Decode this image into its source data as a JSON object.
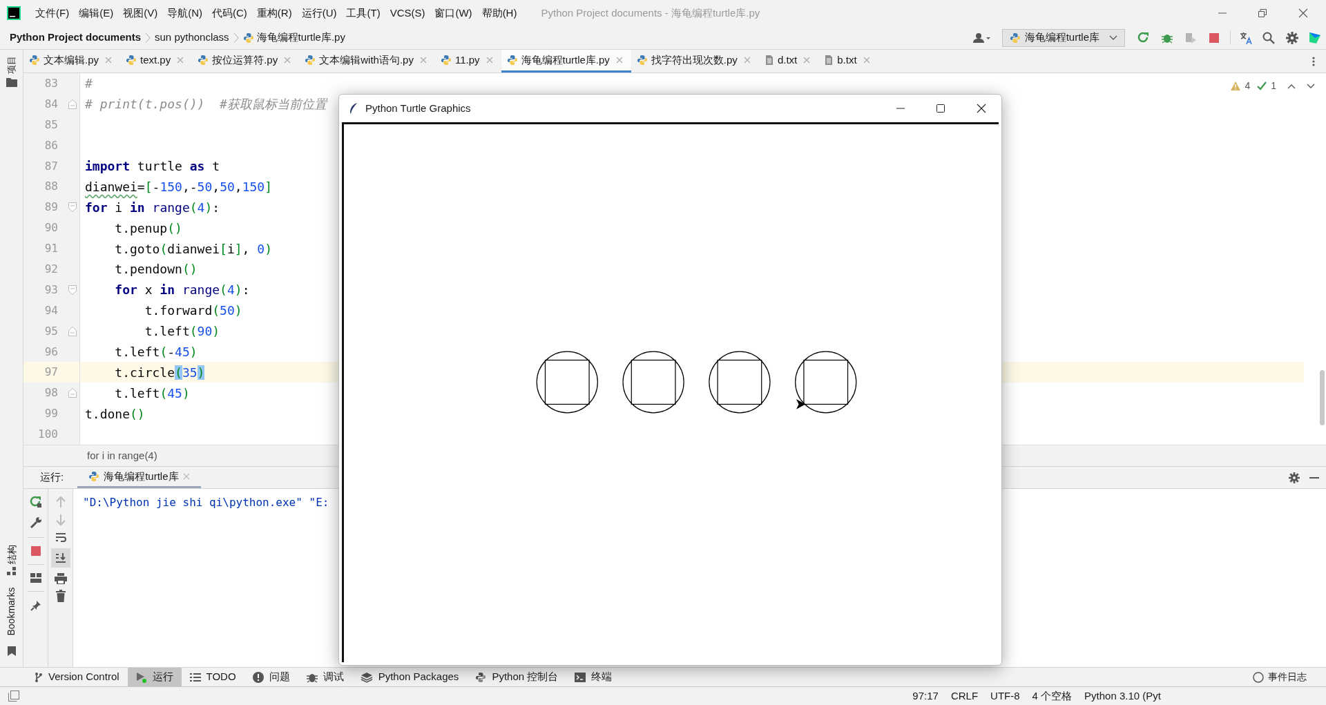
{
  "title_bar": {
    "menus": [
      "文件(F)",
      "编辑(E)",
      "视图(V)",
      "导航(N)",
      "代码(C)",
      "重构(R)",
      "运行(U)",
      "工具(T)",
      "VCS(S)",
      "窗口(W)",
      "帮助(H)"
    ],
    "title": "Python Project documents - 海龟编程turtle库.py"
  },
  "navigation_bar": {
    "breadcrumbs": [
      "Python Project documents",
      "sun pythonclass",
      "海龟编程turtle库.py"
    ],
    "run_configuration": "海龟编程turtle库"
  },
  "left_strip": {
    "top": [
      "项目"
    ],
    "bottom": [
      "结构",
      "Bookmarks"
    ]
  },
  "editor_tabs": [
    {
      "label": "文本编辑.py",
      "kind": "python",
      "selected": false
    },
    {
      "label": "text.py",
      "kind": "python",
      "selected": false
    },
    {
      "label": "按位运算符.py",
      "kind": "python",
      "selected": false
    },
    {
      "label": "文本编辑with语句.py",
      "kind": "python",
      "selected": false
    },
    {
      "label": "11.py",
      "kind": "python",
      "selected": false
    },
    {
      "label": "海龟编程turtle库.py",
      "kind": "python",
      "selected": true
    },
    {
      "label": "找字符出现次数.py",
      "kind": "python",
      "selected": false
    },
    {
      "label": "d.txt",
      "kind": "text",
      "selected": false
    },
    {
      "label": "b.txt",
      "kind": "text",
      "selected": false
    }
  ],
  "editor": {
    "inspections": {
      "warnings": "4",
      "passed": "1"
    },
    "lines": [
      {
        "number": "83",
        "kind": "plain",
        "current": false,
        "tokens": [
          {
            "kind": "comment",
            "text": "#"
          }
        ]
      },
      {
        "number": "84",
        "kind": "fold-end",
        "current": false,
        "tokens": [
          {
            "kind": "comment",
            "text": "# print(t.pos())  #获取鼠标当前位置"
          }
        ]
      },
      {
        "number": "85",
        "kind": "plain",
        "current": false
      },
      {
        "number": "86",
        "kind": "plain",
        "current": false
      },
      {
        "number": "87",
        "kind": "plain",
        "current": false,
        "tokens": [
          {
            "kind": "keyword",
            "text": "import"
          },
          {
            "kind": "plain",
            "text": " turtle "
          },
          {
            "kind": "keyword",
            "text": "as"
          },
          {
            "kind": "plain",
            "text": " t"
          }
        ]
      },
      {
        "number": "88",
        "kind": "plain",
        "current": false,
        "tokens": [
          {
            "kind": "typo",
            "text": "dianwei"
          },
          {
            "kind": "plain",
            "text": "="
          },
          {
            "kind": "bracket",
            "text": "["
          },
          {
            "kind": "plain",
            "text": "-"
          },
          {
            "kind": "number",
            "text": "150"
          },
          {
            "kind": "plain",
            "text": ",-"
          },
          {
            "kind": "number",
            "text": "50"
          },
          {
            "kind": "plain",
            "text": ","
          },
          {
            "kind": "number",
            "text": "50"
          },
          {
            "kind": "plain",
            "text": ","
          },
          {
            "kind": "number",
            "text": "150"
          },
          {
            "kind": "bracket",
            "text": "]"
          }
        ]
      },
      {
        "number": "89",
        "kind": "fold-start",
        "current": false,
        "tokens": [
          {
            "kind": "keyword",
            "text": "for"
          },
          {
            "kind": "plain",
            "text": " i "
          },
          {
            "kind": "keyword",
            "text": "in"
          },
          {
            "kind": "builtin",
            "text": " range"
          },
          {
            "kind": "bracket",
            "text": "("
          },
          {
            "kind": "number",
            "text": "4"
          },
          {
            "kind": "bracket",
            "text": ")"
          },
          {
            "kind": "plain",
            "text": ":"
          }
        ]
      },
      {
        "number": "90",
        "kind": "plain",
        "current": false,
        "tokens": [
          {
            "kind": "plain",
            "text": "    t.penup"
          },
          {
            "kind": "bracket",
            "text": "()"
          }
        ]
      },
      {
        "number": "91",
        "kind": "plain",
        "current": false,
        "tokens": [
          {
            "kind": "plain",
            "text": "    t.goto"
          },
          {
            "kind": "bracket",
            "text": "("
          },
          {
            "kind": "plain",
            "text": "dianwei"
          },
          {
            "kind": "bracket",
            "text": "["
          },
          {
            "kind": "plain",
            "text": "i"
          },
          {
            "kind": "bracket",
            "text": "]"
          },
          {
            "kind": "plain",
            "text": ", "
          },
          {
            "kind": "number",
            "text": "0"
          },
          {
            "kind": "bracket",
            "text": ")"
          }
        ]
      },
      {
        "number": "92",
        "kind": "plain",
        "current": false,
        "tokens": [
          {
            "kind": "plain",
            "text": "    t.pendown"
          },
          {
            "kind": "bracket",
            "text": "()"
          }
        ]
      },
      {
        "number": "93",
        "kind": "fold-start",
        "current": false,
        "tokens": [
          {
            "kind": "keyword",
            "text": "    for"
          },
          {
            "kind": "plain",
            "text": " x "
          },
          {
            "kind": "keyword",
            "text": "in"
          },
          {
            "kind": "builtin",
            "text": " range"
          },
          {
            "kind": "bracket",
            "text": "("
          },
          {
            "kind": "number",
            "text": "4"
          },
          {
            "kind": "bracket",
            "text": ")"
          },
          {
            "kind": "plain",
            "text": ":"
          }
        ]
      },
      {
        "number": "94",
        "kind": "plain",
        "current": false,
        "tokens": [
          {
            "kind": "plain",
            "text": "        t.forward"
          },
          {
            "kind": "bracket",
            "text": "("
          },
          {
            "kind": "number",
            "text": "50"
          },
          {
            "kind": "bracket",
            "text": ")"
          }
        ]
      },
      {
        "number": "95",
        "kind": "fold-end",
        "current": false,
        "tokens": [
          {
            "kind": "plain",
            "text": "        t.left"
          },
          {
            "kind": "bracket",
            "text": "("
          },
          {
            "kind": "number",
            "text": "90"
          },
          {
            "kind": "bracket",
            "text": ")"
          }
        ]
      },
      {
        "number": "96",
        "kind": "plain",
        "current": false,
        "tokens": [
          {
            "kind": "plain",
            "text": "    t.left"
          },
          {
            "kind": "bracket",
            "text": "("
          },
          {
            "kind": "plain",
            "text": "-"
          },
          {
            "kind": "number",
            "text": "45"
          },
          {
            "kind": "bracket",
            "text": ")"
          }
        ]
      },
      {
        "number": "97",
        "kind": "plain",
        "current": true,
        "tokens": [
          {
            "kind": "plain",
            "text": "    t.circle"
          },
          {
            "kind": "matched",
            "text": "("
          },
          {
            "kind": "number",
            "text": "35"
          },
          {
            "kind": "matched",
            "text": ")"
          }
        ]
      },
      {
        "number": "98",
        "kind": "fold-end",
        "current": false,
        "tokens": [
          {
            "kind": "plain",
            "text": "    t.left"
          },
          {
            "kind": "bracket",
            "text": "("
          },
          {
            "kind": "number",
            "text": "45"
          },
          {
            "kind": "bracket",
            "text": ")"
          }
        ]
      },
      {
        "number": "99",
        "kind": "plain",
        "current": false,
        "tokens": [
          {
            "kind": "plain",
            "text": "t.done"
          },
          {
            "kind": "bracket",
            "text": "()"
          }
        ]
      },
      {
        "number": "100",
        "kind": "plain",
        "current": false
      }
    ],
    "breadcrumb": "for i in range(4)"
  },
  "run_panel": {
    "label": "运行:",
    "tab": "海龟编程turtle库",
    "output": "\"D:\\Python jie shi qi\\python.exe\" \"E:"
  },
  "turtle_window": {
    "title": "Python Turtle Graphics"
  },
  "tool_window_bar": [
    {
      "label": "Version Control",
      "kind": "branch",
      "selected": false
    },
    {
      "label": "运行",
      "kind": "run",
      "selected": true
    },
    {
      "label": "TODO",
      "kind": "list",
      "selected": false
    },
    {
      "label": "问题",
      "kind": "alert",
      "selected": false
    },
    {
      "label": "调试",
      "kind": "bug",
      "selected": false
    },
    {
      "label": "Python Packages",
      "kind": "layers",
      "selected": false
    },
    {
      "label": "Python 控制台",
      "kind": "python",
      "selected": false
    },
    {
      "label": "终端",
      "kind": "terminal",
      "selected": false
    }
  ],
  "event_log": "事件日志",
  "status_bar": [
    "97:17",
    "CRLF",
    "UTF-8",
    "4 个空格",
    "Python 3.10 (Pyt"
  ]
}
